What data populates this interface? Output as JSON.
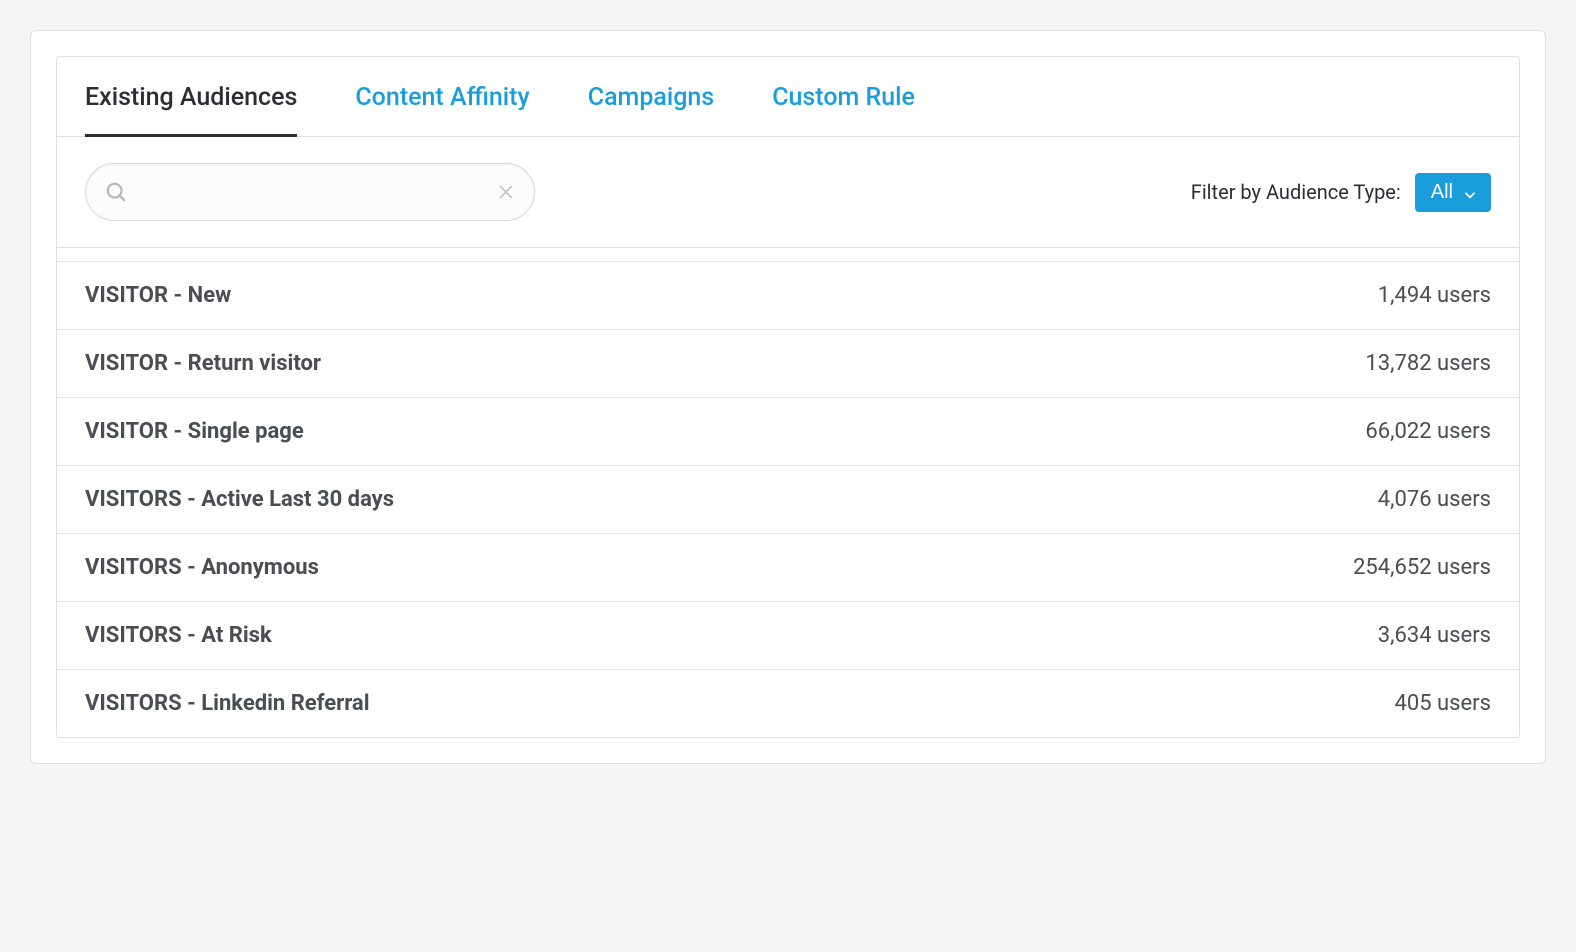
{
  "tabs": [
    {
      "label": "Existing Audiences",
      "active": true
    },
    {
      "label": "Content Affinity",
      "active": false
    },
    {
      "label": "Campaigns",
      "active": false
    },
    {
      "label": "Custom Rule",
      "active": false
    }
  ],
  "search": {
    "value": "",
    "placeholder": ""
  },
  "filter": {
    "label": "Filter by Audience Type:",
    "selected": "All"
  },
  "audiences": [
    {
      "name": "VISITOR - New",
      "count": "1,494 users"
    },
    {
      "name": "VISITOR - Return visitor",
      "count": "13,782 users"
    },
    {
      "name": "VISITOR - Single page",
      "count": "66,022 users"
    },
    {
      "name": "VISITORS - Active Last 30 days",
      "count": "4,076 users"
    },
    {
      "name": "VISITORS - Anonymous",
      "count": "254,652 users"
    },
    {
      "name": "VISITORS - At Risk",
      "count": "3,634 users"
    },
    {
      "name": "VISITORS - Linkedin Referral",
      "count": "405 users"
    }
  ]
}
